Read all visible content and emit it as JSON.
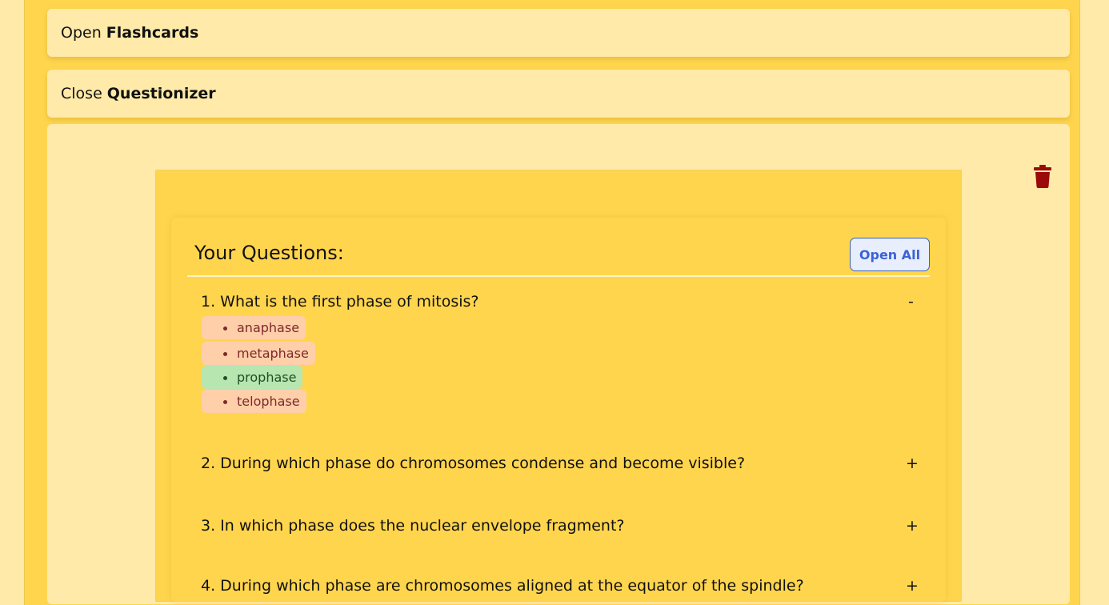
{
  "bars": {
    "flashcards": {
      "verb": "Open",
      "name": "Flashcards"
    },
    "questionizer": {
      "verb": "Close",
      "name": "Questionizer"
    }
  },
  "questions_panel": {
    "heading": "Your Questions:",
    "open_all_label": "Open All",
    "items": [
      {
        "text": "1. What is the first phase of mitosis?",
        "toggle": "-",
        "options": [
          {
            "label": "anaphase",
            "status": "wrong"
          },
          {
            "label": "metaphase",
            "status": "wrong"
          },
          {
            "label": "prophase",
            "status": "correct"
          },
          {
            "label": "telophase",
            "status": "wrong"
          }
        ]
      },
      {
        "text": "2. During which phase do chromosomes condense and become visible?",
        "toggle": "+"
      },
      {
        "text": "3. In which phase does the nuclear envelope fragment?",
        "toggle": "+"
      },
      {
        "text": "4. During which phase are chromosomes aligned at the equator of the spindle?",
        "toggle": "+"
      }
    ]
  },
  "colors": {
    "background": "#ffeaa9",
    "accent": "#ffd54e",
    "trash": "#9b0a0a",
    "correct": "#b8e6b0",
    "wrong": "#ffcfaa",
    "button_text": "#3a63d6"
  },
  "icons": {
    "delete": "trash-icon"
  }
}
